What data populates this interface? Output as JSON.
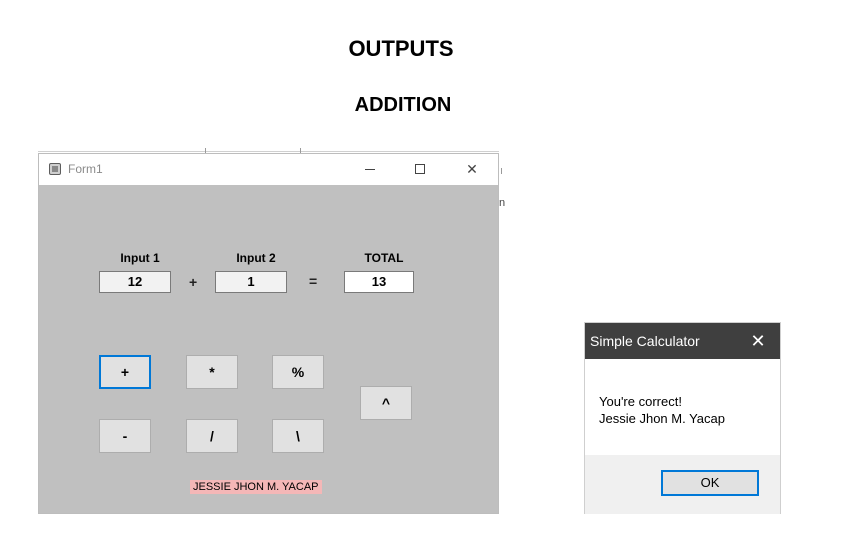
{
  "headings": {
    "outputs": "OUTPUTS",
    "addition": "ADDITION"
  },
  "form1": {
    "title": "Form1",
    "labels": {
      "input1": "Input 1",
      "input2": "Input 2",
      "total": "TOTAL"
    },
    "values": {
      "input1": "12",
      "input2": "1",
      "total": "13"
    },
    "operators": {
      "plus": "+",
      "equals": "="
    },
    "buttons": {
      "add": "+",
      "multiply": "*",
      "percent": "%",
      "power": "^",
      "subtract": "-",
      "divide": "/",
      "int_divide": "\\"
    },
    "name_label": "JESSIE JHON M. YACAP"
  },
  "dialog": {
    "title": "Simple Calculator",
    "message_line1": "You're correct!",
    "message_line2": "Jessie Jhon M. Yacap",
    "ok_label": "OK"
  },
  "stray": {
    "char": "n"
  },
  "colors": {
    "form_bg": "#c0c0c0",
    "focus_border": "#0078d7",
    "name_label_bg": "#f4b7b7",
    "dialog_titlebar": "#3f3f3f"
  }
}
